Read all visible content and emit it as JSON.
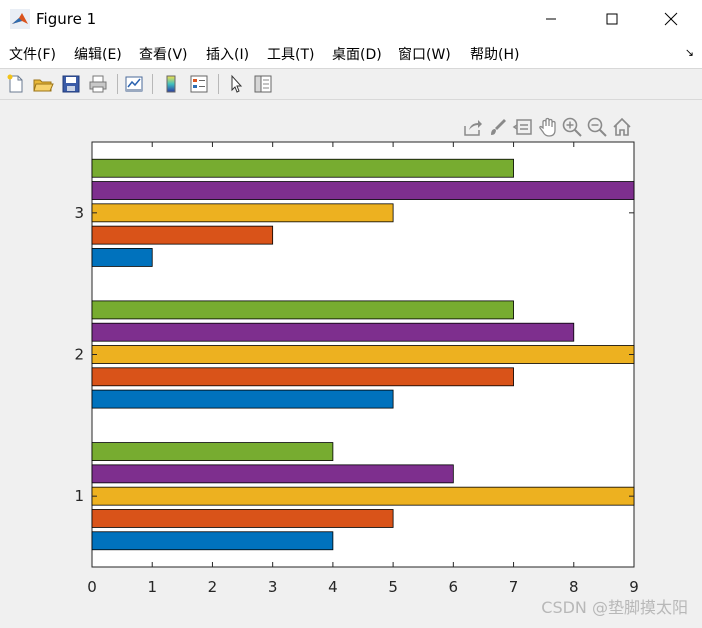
{
  "window": {
    "title": "Figure 1",
    "minimize_icon": "minimize-icon",
    "maximize_icon": "maximize-icon",
    "close_icon": "close-icon"
  },
  "menu": {
    "items": [
      {
        "label": "文件(F)"
      },
      {
        "label": "编辑(E)"
      },
      {
        "label": "查看(V)"
      },
      {
        "label": "插入(I)"
      },
      {
        "label": "工具(T)"
      },
      {
        "label": "桌面(D)"
      },
      {
        "label": "窗口(W)"
      },
      {
        "label": "帮助(H)"
      }
    ],
    "overflow_icon": "↘"
  },
  "toolbar": {
    "icons": [
      "new-figure-icon",
      "open-icon",
      "save-icon",
      "print-icon",
      "link-plot-icon",
      "colorbar-icon",
      "legend-icon",
      "edit-plot-icon",
      "property-inspector-icon"
    ]
  },
  "axes_toolbar": {
    "icons": [
      "export-icon",
      "brush-icon",
      "data-tips-icon",
      "pan-icon",
      "zoom-in-icon",
      "zoom-out-icon",
      "home-icon"
    ]
  },
  "watermark": "CSDN @垫脚摸太阳",
  "colors": {
    "series1": "#0072bd",
    "series2": "#d95319",
    "series3": "#edb120",
    "series4": "#7e2f8e",
    "series5": "#77ac30"
  },
  "chart_data": {
    "type": "bar",
    "orientation": "horizontal",
    "categories": [
      "1",
      "2",
      "3"
    ],
    "series": [
      {
        "values": [
          4,
          5,
          1
        ],
        "color": "#0072bd"
      },
      {
        "values": [
          5,
          7,
          3
        ],
        "color": "#d95319"
      },
      {
        "values": [
          9,
          9,
          5
        ],
        "color": "#edb120"
      },
      {
        "values": [
          6,
          8,
          9
        ],
        "color": "#7e2f8e"
      },
      {
        "values": [
          4,
          7,
          7
        ],
        "color": "#77ac30"
      }
    ],
    "xlim": [
      0,
      9
    ],
    "xticks": [
      "0",
      "1",
      "2",
      "3",
      "4",
      "5",
      "6",
      "7",
      "8",
      "9"
    ],
    "yticks": [
      "1",
      "2",
      "3"
    ],
    "title": "",
    "xlabel": "",
    "ylabel": "",
    "grid": false,
    "legend": "none"
  }
}
